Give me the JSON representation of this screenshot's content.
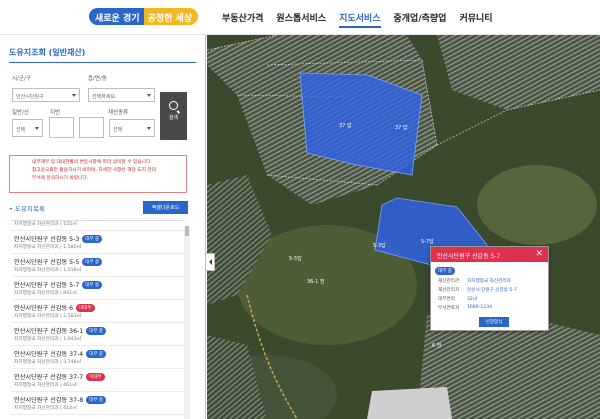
{
  "header": {
    "brand_left": "새로운 경기",
    "brand_right": "공정한 세상",
    "nav": [
      "부동산가격",
      "원스톱서비스",
      "지도서비스",
      "중개업/측량업",
      "커뮤니티"
    ]
  },
  "panel": {
    "title": "도유지조회 (일반재산)",
    "labels": {
      "sigungu": "시/군/구",
      "eupmyeondong": "읍/면/동",
      "san": "일반/산",
      "jibun": "지번",
      "category": "재산종류"
    },
    "selects": {
      "sigungu": "안산시단원구",
      "eupmyeondong": "선택하세요.",
      "san": "선택",
      "category": "선택"
    },
    "search_label": "검색",
    "notice": [
      "내부재부 및 대내현황의 변동사항에 따라 상이할 수 있습니다.",
      "참고용으로만 활용하시기 바라며, 자세한 사항은 해당 도지 관리",
      "부서에 문의하시기 바랍니다."
    ],
    "list_title": "도유지목록",
    "download_label": "엑셀다운로드",
    "list_top_sub": "자치행정국 자산관리과 | 155㎡",
    "items": [
      {
        "name": "안산시단원구 선감동 5-3",
        "badge": "대부 중",
        "badge_color": "blue",
        "sub": "자치행정국 자산관리과 | 1,580㎡"
      },
      {
        "name": "안산시단원구 선감동 5-5",
        "badge": "대부 중",
        "badge_color": "blue",
        "sub": "자치행정국 자산관리과 | 1,018㎡"
      },
      {
        "name": "안산시단원구 선감동 5-7",
        "badge": "대부 중",
        "badge_color": "blue",
        "sub": "자치행정국 자산관리과 | 841㎡"
      },
      {
        "name": "안산시단원구 선감동 6",
        "badge": "미대부",
        "badge_color": "red",
        "sub": "자치행정국 자산관리과 | 2,583㎡"
      },
      {
        "name": "안산시단원구 선감동 36-1",
        "badge": "대부 중",
        "badge_color": "blue",
        "sub": "자치행정국 자산관리과 | 1,043㎡"
      },
      {
        "name": "안산시단원구 선감동 37-4",
        "badge": "대부 중",
        "badge_color": "blue",
        "sub": "자치행정국 자산관리과 | 3,748㎡"
      },
      {
        "name": "안산시단원구 선감동 37-7",
        "badge": "미대부",
        "badge_color": "red",
        "sub": "자치행정국 자산관리과 | 461㎡"
      },
      {
        "name": "안산시단원구 선감동 37-8",
        "badge": "대부 중",
        "badge_color": "blue",
        "sub": "자치행정국 자산관리과 | 414㎡"
      }
    ]
  },
  "map": {
    "parcel_labels": [
      "37 답",
      "37 답",
      "5-3답",
      "5-7답",
      "5-5답",
      "36-1 전",
      "6 전"
    ],
    "popup": {
      "title": "안산시단원구 선감동 5-7",
      "badge": "대부 중",
      "rows": [
        {
          "label": "재산관리관",
          "value": "자치행정국 자산관리과"
        },
        {
          "label": "재산관리처",
          "value": "안산시 단원구 선감동 5-7"
        },
        {
          "label": "대부면적",
          "value": "32㎡"
        },
        {
          "label": "부서연락처",
          "value": "1666-1234"
        }
      ],
      "button": "신청양식"
    }
  },
  "colors": {
    "accent": "#2a66c8",
    "alert": "#e0304f",
    "parcel_fill": "#2f62e8"
  }
}
